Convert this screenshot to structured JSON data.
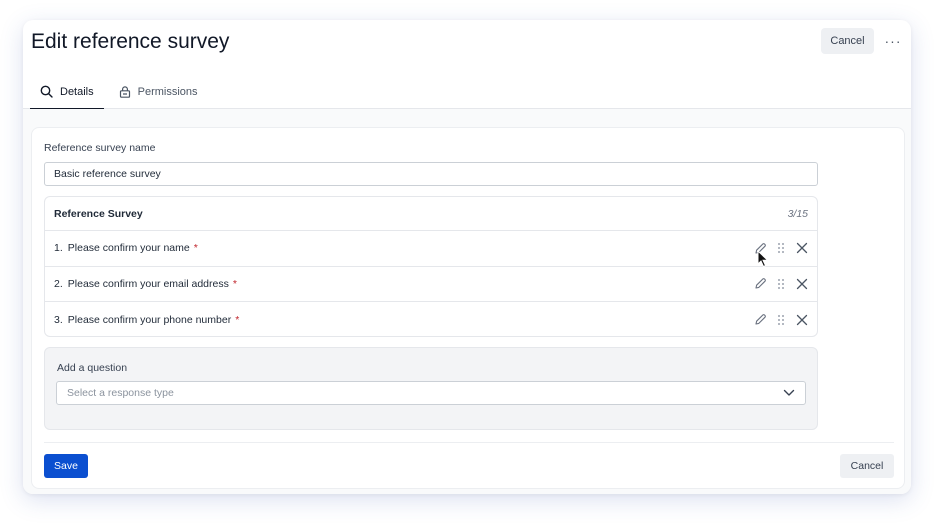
{
  "header": {
    "title": "Edit reference survey",
    "cancel_label": "Cancel",
    "more_label": "···"
  },
  "tabs": [
    {
      "label": "Details",
      "icon": "search-icon",
      "active": true
    },
    {
      "label": "Permissions",
      "icon": "lock-icon",
      "active": false
    }
  ],
  "form": {
    "name_label": "Reference survey name",
    "name_value": "Basic reference survey",
    "survey": {
      "title": "Reference Survey",
      "count": "3/15",
      "questions": [
        {
          "number": "1.",
          "text": "Please confirm your name",
          "required_mark": "*"
        },
        {
          "number": "2.",
          "text": "Please confirm your email address",
          "required_mark": "*"
        },
        {
          "number": "3.",
          "text": "Please confirm your phone number",
          "required_mark": "*"
        }
      ]
    },
    "add_question": {
      "label": "Add a question",
      "select_placeholder": "Select a response type"
    }
  },
  "footer": {
    "save_label": "Save",
    "cancel_label": "Cancel"
  },
  "colors": {
    "primary": "#0b4fd0",
    "required": "#c0262d"
  }
}
